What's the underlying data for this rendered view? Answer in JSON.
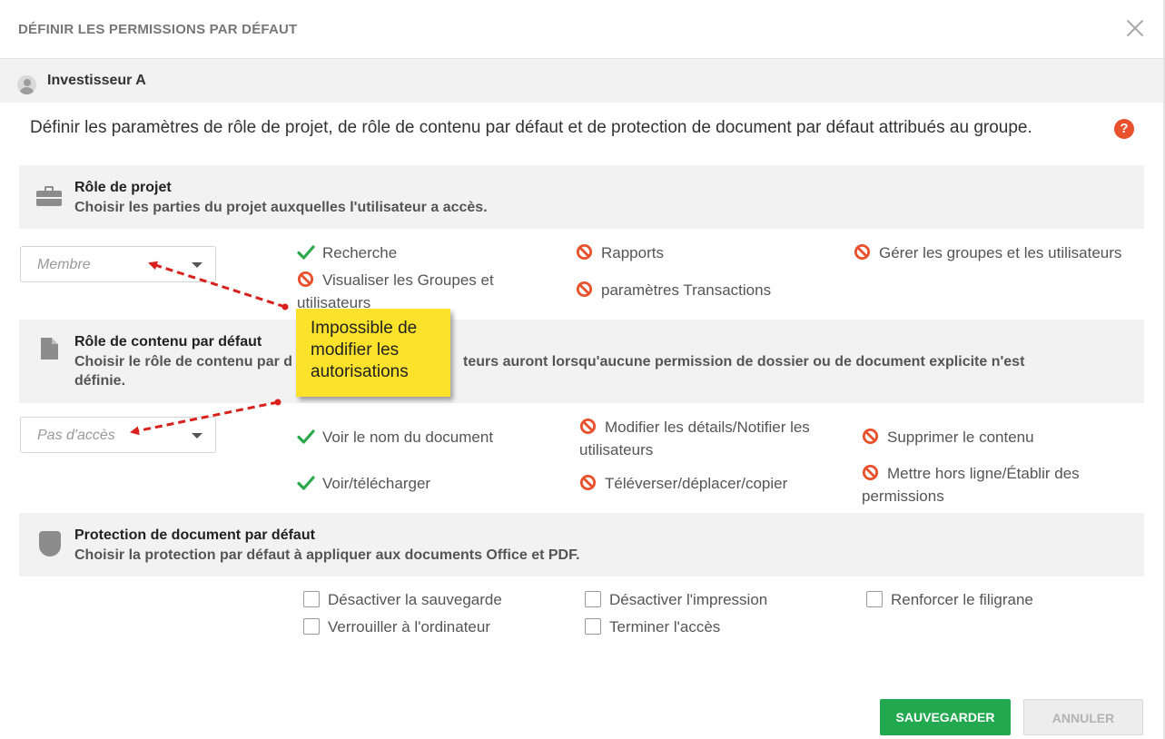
{
  "dialog": {
    "title": "DÉFINIR LES PERMISSIONS PAR DÉFAUT",
    "user_name": "Investisseur A",
    "intro": "Définir les paramètres de rôle de projet, de rôle de contenu par défaut et de protection de document par défaut attribués au groupe.",
    "help_label": "?"
  },
  "project_role": {
    "title": "Rôle de projet",
    "subtitle": "Choisir les parties du projet auxquelles l'utilisateur a accès.",
    "selected": "Membre",
    "permissions": [
      {
        "label": "Recherche",
        "status": "allowed"
      },
      {
        "label": "Rapports",
        "status": "denied"
      },
      {
        "label": "Gérer les groupes et les utilisateurs",
        "status": "denied"
      },
      {
        "label": "Visualiser les Groupes et utilisateurs",
        "status": "denied"
      },
      {
        "label": "paramètres Transactions",
        "status": "denied"
      }
    ]
  },
  "content_role": {
    "title": "Rôle de contenu par défaut",
    "subtitle_part1": "Choisir le rôle de contenu par d",
    "subtitle_part2": "teurs auront lorsqu'aucune permission de dossier ou de document explicite n'est",
    "subtitle_part3": "définie.",
    "selected": "Pas d'accès",
    "permissions": [
      {
        "label": "Voir le nom du document",
        "status": "allowed"
      },
      {
        "label": "Modifier les détails/Notifier les utilisateurs",
        "status": "denied"
      },
      {
        "label": "Supprimer le contenu",
        "status": "denied"
      },
      {
        "label": "Voir/télécharger",
        "status": "allowed"
      },
      {
        "label": "Téléverser/déplacer/copier",
        "status": "denied"
      },
      {
        "label": "Mettre hors ligne/Établir des permissions",
        "status": "denied"
      }
    ]
  },
  "protection": {
    "title": "Protection de document par défaut",
    "subtitle": "Choisir la protection par défaut à appliquer aux documents Office et PDF.",
    "options": [
      {
        "label": "Désactiver la sauvegarde",
        "checked": false
      },
      {
        "label": "Désactiver l'impression",
        "checked": false
      },
      {
        "label": "Renforcer le filigrane",
        "checked": false
      },
      {
        "label": "Verrouiller à l'ordinateur",
        "checked": false
      },
      {
        "label": "Terminer l'accès",
        "checked": false
      }
    ]
  },
  "callout": {
    "text": "Impossible de modifier les autorisations"
  },
  "footer": {
    "save_label": "SAUVEGARDER",
    "cancel_label": "ANNULER"
  },
  "colors": {
    "allowed": "#2aa84a",
    "denied": "#e8512c",
    "primary_button": "#22a94f",
    "callout": "#fde22b",
    "arrow": "#d8201c"
  },
  "icons": {
    "allowed": "check-icon",
    "denied": "prohibited-icon"
  }
}
